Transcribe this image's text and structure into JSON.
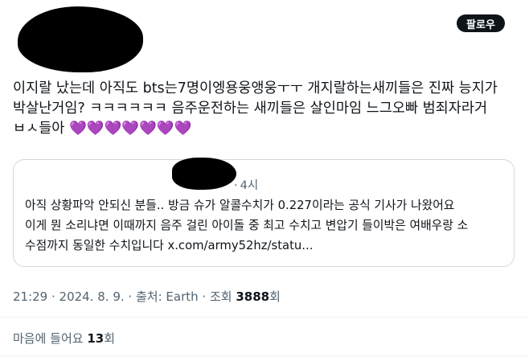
{
  "header": {
    "follow_label": "팔로우"
  },
  "tweet": {
    "text": "이지랄 났는데 아직도 bts는7명이엥용웅앵웅ㅜㅜ 개지랄하는새끼들은 진짜 능지가\n박살난거임? ㅋㅋㅋㅋㅋㅋ 음주운전하는 새끼들은 살인마임 느그오빠 범죄자라거\nㅂㅅ들아 ",
    "hearts": "💜💜💜💜💜💜💜"
  },
  "quote": {
    "time_dot": "·",
    "time": "4시",
    "body": "아직 상황파악 안되신 분들.. 방금 슈가 알콜수치가 0.227이라는 공식 기사가 나왔어요\n이게 뭔 소리냐면 이때까지 음주 걸린 아이돌 중 최고 수치고 변압기 들이박은 여배우랑 소\n수점까지 동일한 수치입니다 x.com/army52hz/statu..."
  },
  "meta": {
    "time": "21:29",
    "sep1": " · ",
    "date": "2024. 8. 9.",
    "sep2": " · ",
    "source_label": "출처: ",
    "source": "Earth",
    "sep3": " · ",
    "views_label": "조회 ",
    "views": "3888",
    "views_unit": "회"
  },
  "likes": {
    "label": "마음에 들어요 ",
    "count": "13",
    "unit": "회"
  }
}
